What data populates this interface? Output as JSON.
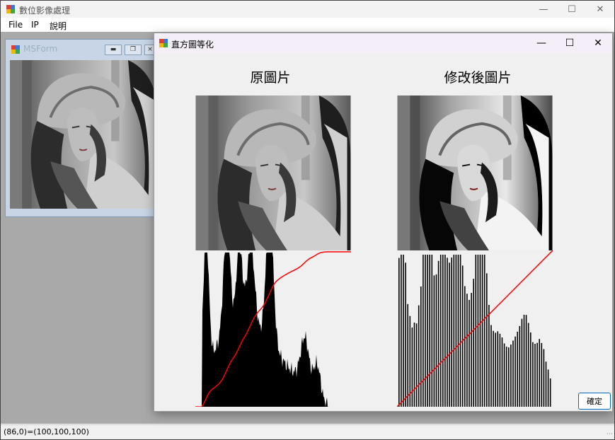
{
  "app": {
    "title": "數位影像處理"
  },
  "menu": {
    "items": [
      "File",
      "IP",
      "說明"
    ]
  },
  "status": {
    "text": "(86,0)=(100,100,100)"
  },
  "child_window": {
    "title": "MSForm"
  },
  "dialog": {
    "title": "直方圖等化",
    "original_label": "原圖片",
    "modified_label": "修改後圖片",
    "ok_label": "確定"
  },
  "colors": {
    "cdf_line": "#ff0000",
    "histogram_bar": "#000000",
    "mdi_background": "#a9a9a9",
    "ok_border": "#0067c0"
  }
}
